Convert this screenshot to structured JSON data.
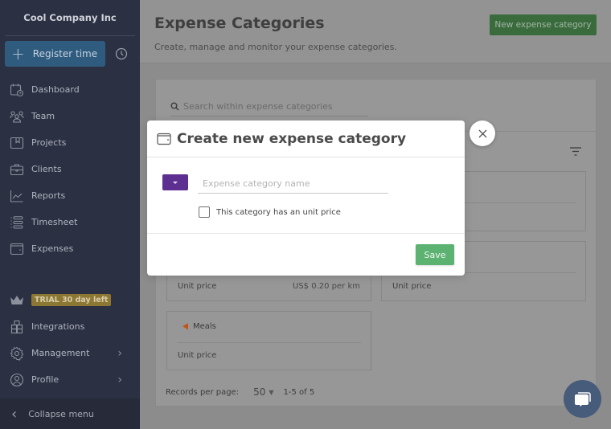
{
  "sidebar": {
    "company": "Cool Company Inc",
    "register_label": "Register time",
    "items": [
      {
        "label": "Dashboard",
        "icon": "calendar-clock-icon"
      },
      {
        "label": "Team",
        "icon": "team-icon"
      },
      {
        "label": "Projects",
        "icon": "folder-icon"
      },
      {
        "label": "Clients",
        "icon": "briefcase-icon"
      },
      {
        "label": "Reports",
        "icon": "chart-line-icon"
      },
      {
        "label": "Timesheet",
        "icon": "timesheet-icon"
      },
      {
        "label": "Expenses",
        "icon": "wallet-icon"
      }
    ],
    "trial_label": "TRIAL 30 day left",
    "bottom_items": [
      {
        "label": "Integrations",
        "icon": "cubes-icon"
      },
      {
        "label": "Management",
        "icon": "gear-icon"
      },
      {
        "label": "Profile",
        "icon": "user-circle-icon"
      }
    ],
    "collapse_label": "Collapse menu"
  },
  "header": {
    "title": "Expense Categories",
    "subtitle": "Create, manage and monitor your expense categories.",
    "new_button": "New expense category"
  },
  "list": {
    "search_placeholder": "Search within expense categories",
    "cards": [
      {
        "name": "",
        "unit_label": "Unit price",
        "unit_value": "US$ 0.20 per km"
      },
      {
        "name": "",
        "unit_label": "Unit price",
        "unit_value": ""
      },
      {
        "name": "Meals",
        "unit_label": "Unit price",
        "unit_value": ""
      }
    ],
    "records_label": "Records per page:",
    "per_page": "50",
    "range": "1-5 of 5"
  },
  "modal": {
    "title": "Create new expense category",
    "name_placeholder": "Expense category name",
    "name_value": "",
    "color": "#5d2f91",
    "unit_price_label": "This category has an unit price",
    "unit_price_checked": false,
    "save_label": "Save"
  },
  "colors": {
    "sidebar_bg": "#2b3042",
    "register_btn": "#2f5b7f",
    "new_btn": "#3a6b3d",
    "save_btn": "#5cb270",
    "chat_btn": "#475b7a",
    "trial_badge": "#8c7733"
  }
}
